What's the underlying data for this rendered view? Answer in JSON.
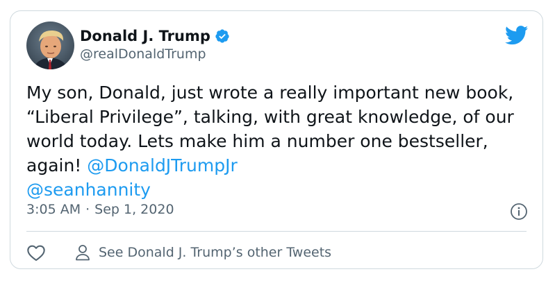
{
  "user": {
    "display_name": "Donald J. Trump",
    "handle": "@realDonaldTrump"
  },
  "tweet": {
    "text_before": "My son, Donald, just wrote a really important new book, “Liberal Privilege”, talking, with great knowledge, of our world today. Lets make him a number one bestseller, again! ",
    "mention_1": "@DonaldJTrumpJr",
    "mention_2": "@seanhannity"
  },
  "meta": {
    "time": "3:05 AM",
    "separator": "·",
    "date": "Sep 1, 2020"
  },
  "actions": {
    "other_tweets_label": "See Donald J. Trump’s other Tweets"
  },
  "icons": {
    "brand": "twitter-bird-icon",
    "verified": "verified-badge-icon",
    "info": "info-icon",
    "like": "heart-icon",
    "profile": "person-icon"
  },
  "colors": {
    "accent": "#1d9bf0",
    "text": "#0f1419",
    "secondary": "#536471",
    "border": "#cfd9de"
  }
}
